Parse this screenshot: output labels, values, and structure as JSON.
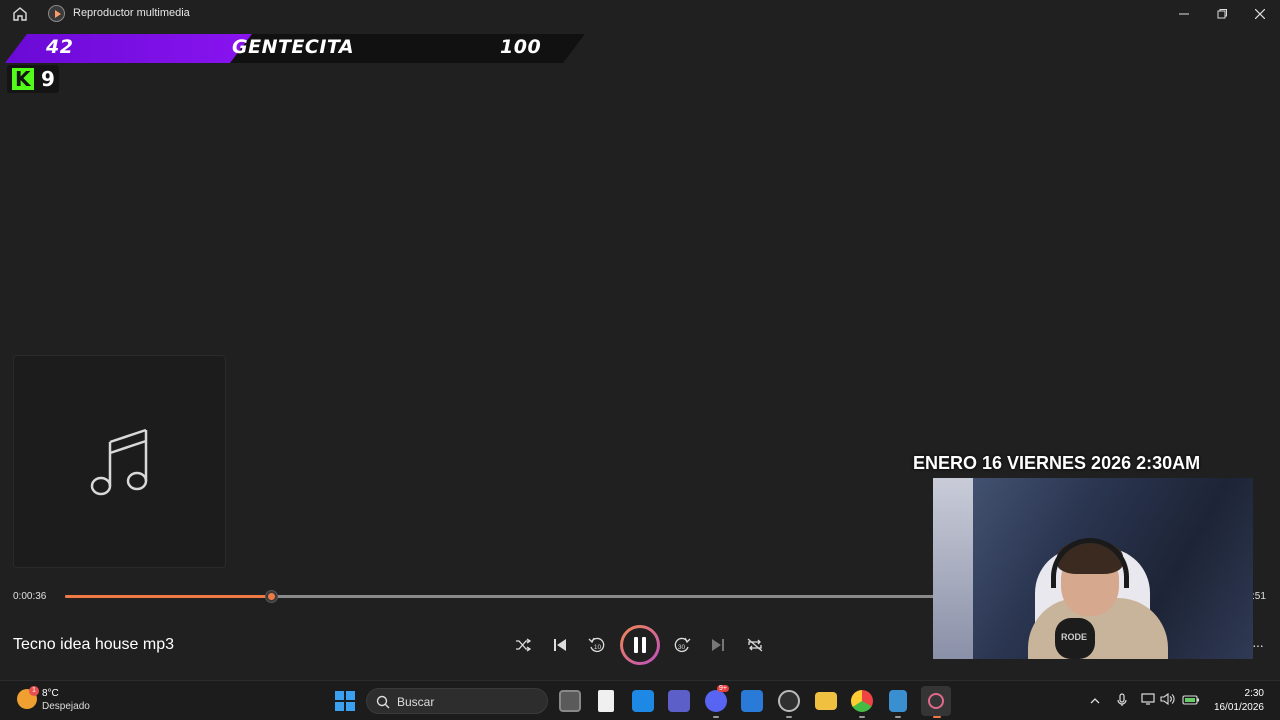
{
  "window": {
    "title": "Reproductor multimedia",
    "controls": [
      "minimize-icon",
      "maximize-icon",
      "close-icon"
    ]
  },
  "stream_overlay": {
    "score_left": "42",
    "name": "GENTECITA",
    "score_right": "100",
    "kick_viewers": "9",
    "date_text": "ENERO 16 VIERNES 2026 2:30AM"
  },
  "player": {
    "current_time": "0:00:36",
    "end_time": ":51",
    "progress_fraction": 0.174,
    "song_title": "Tecno idea house mp3",
    "accent_color": "#f07a45",
    "controls": [
      "shuffle-icon",
      "previous-icon",
      "rewind-10-icon",
      "pause-icon",
      "forward-30-icon",
      "next-icon",
      "repeat-icon"
    ],
    "rewind_label": "10",
    "forward_label": "30",
    "more_label": "···"
  },
  "webcam": {
    "mic_label": "RODE"
  },
  "taskbar": {
    "weather": {
      "temp": "8°C",
      "desc": "Despejado",
      "badge": "1"
    },
    "search_placeholder": "Buscar",
    "apps": [
      "task-view",
      "notepad",
      "mail",
      "teams",
      "discord",
      "store",
      "obs",
      "file-explorer",
      "chrome",
      "notepad-plus",
      "media-player"
    ],
    "discord_badge": "9+",
    "clock_time": "2:30",
    "clock_date": "16/01/2026"
  }
}
